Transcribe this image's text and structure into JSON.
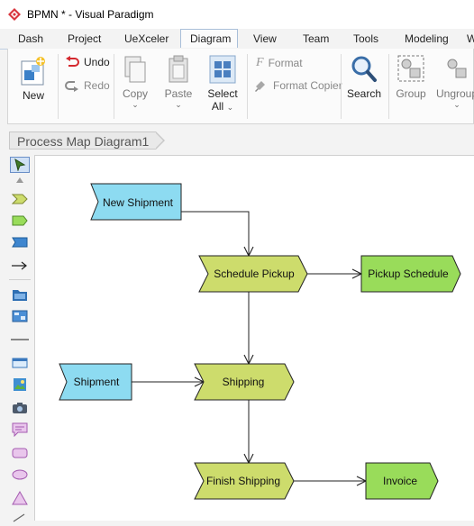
{
  "window": {
    "title": "BPMN * - Visual Paradigm"
  },
  "tabs": [
    "Dash",
    "Project",
    "UeXceler",
    "Diagram",
    "View",
    "Team",
    "Tools",
    "Modeling",
    "W"
  ],
  "active_tab": "Diagram",
  "ribbon": {
    "new": "New",
    "undo": "Undo",
    "redo": "Redo",
    "copy": "Copy",
    "paste": "Paste",
    "select_all_1": "Select",
    "select_all_2": "All",
    "format": "Format",
    "format_copier": "Format Copier",
    "search": "Search",
    "group": "Group",
    "ungroup": "Ungroup"
  },
  "breadcrumb": "Process Map Diagram1",
  "diagram": {
    "shapes": [
      {
        "id": "new-shipment",
        "label": "New Shipment",
        "color": "#8ddbf1"
      },
      {
        "id": "schedule-pickup",
        "label": "Schedule Pickup",
        "color": "#cddc6c"
      },
      {
        "id": "pickup-schedule",
        "label": "Pickup Schedule",
        "color": "#99dc5a"
      },
      {
        "id": "shipment",
        "label": "Shipment",
        "color": "#8ddbf1"
      },
      {
        "id": "shipping",
        "label": "Shipping",
        "color": "#cddc6c"
      },
      {
        "id": "finish-shipping",
        "label": "Finish Shipping",
        "color": "#cddc6c"
      },
      {
        "id": "invoice",
        "label": "Invoice",
        "color": "#99dc5a"
      }
    ]
  }
}
